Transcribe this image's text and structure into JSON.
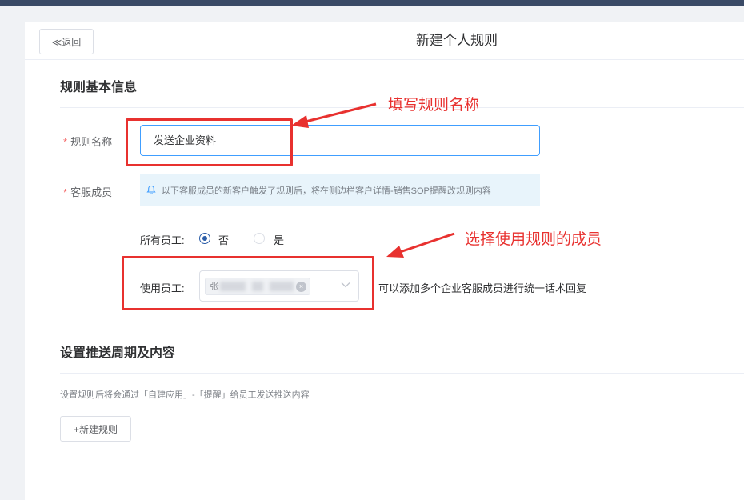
{
  "header": {
    "back_label": "≪返回",
    "title": "新建个人规则"
  },
  "basic": {
    "section_title": "规则基本信息",
    "name_label": "规则名称",
    "name_value": "发送企业资料",
    "members_label": "客服成员",
    "notice": "以下客服成员的新客户触发了规则后，将在侧边栏客户详情-销售SOP提醒改规则内容",
    "all_staff_label": "所有员工:",
    "option_no": "否",
    "option_yes": "是",
    "use_staff_label": "使用员工:",
    "staff_tag_visible": "张",
    "staff_hint": "可以添加多个企业客服成员进行统一话术回复"
  },
  "push": {
    "section_title": "设置推送周期及内容",
    "description": "设置规则后将会通过「自建应用」-「提醒」给员工发送推送内容",
    "new_rule_label": "+新建规则"
  },
  "annotations": {
    "fill_name": "填写规则名称",
    "select_members": "选择使用规则的成员",
    "color": "#e8312f"
  },
  "colors": {
    "accent": "#409eff",
    "radio_selected": "#2b5da8",
    "topbar": "#3a4a66"
  }
}
